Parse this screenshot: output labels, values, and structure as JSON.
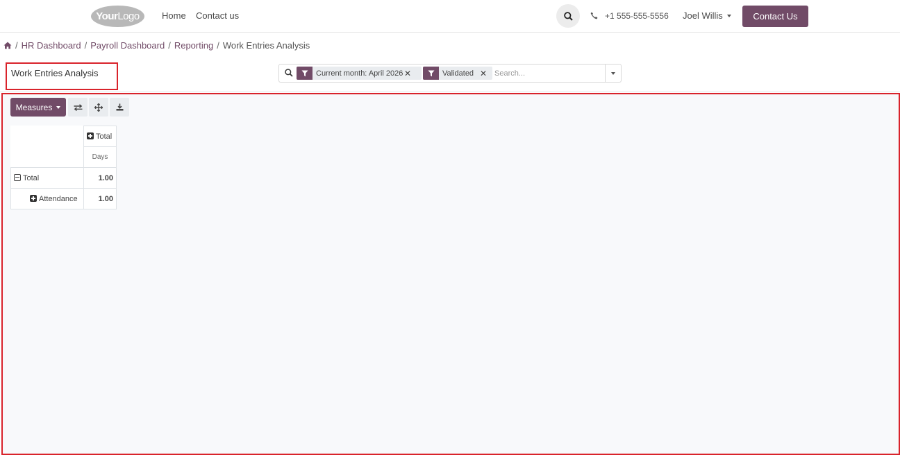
{
  "header": {
    "logo_bold": "Your",
    "logo_text": "Logo",
    "nav": [
      {
        "label": "Home"
      },
      {
        "label": "Contact us"
      }
    ],
    "phone": "+1 555-555-5556",
    "user": "Joel Willis",
    "contact_button": "Contact Us",
    "icons": {
      "search": "search-icon",
      "phone": "phone-icon",
      "caret": "chevron-down-icon"
    }
  },
  "breadcrumb": {
    "home_icon": "home-icon",
    "items": [
      {
        "label": "HR Dashboard"
      },
      {
        "label": "Payroll Dashboard"
      },
      {
        "label": "Reporting"
      }
    ],
    "current": "Work Entries Analysis"
  },
  "page": {
    "title": "Work Entries Analysis"
  },
  "search": {
    "facets": [
      {
        "label": "Current month: April 2026",
        "icon": "filter-icon"
      },
      {
        "label": "Validated",
        "icon": "filter-icon"
      }
    ],
    "placeholder": "Search..."
  },
  "toolbar": {
    "measures_label": "Measures",
    "tools": [
      {
        "name": "flip-axis-icon"
      },
      {
        "name": "expand-all-icon"
      },
      {
        "name": "download-icon"
      }
    ]
  },
  "pivot": {
    "column_header": "Total",
    "measure": "Days",
    "rows": [
      {
        "label": "Total",
        "value": "1.00",
        "expanded": true
      },
      {
        "label": "Attendance",
        "value": "1.00",
        "expanded": false
      }
    ]
  },
  "colors": {
    "brand": "#714b67",
    "highlight_border": "#d9232b"
  }
}
